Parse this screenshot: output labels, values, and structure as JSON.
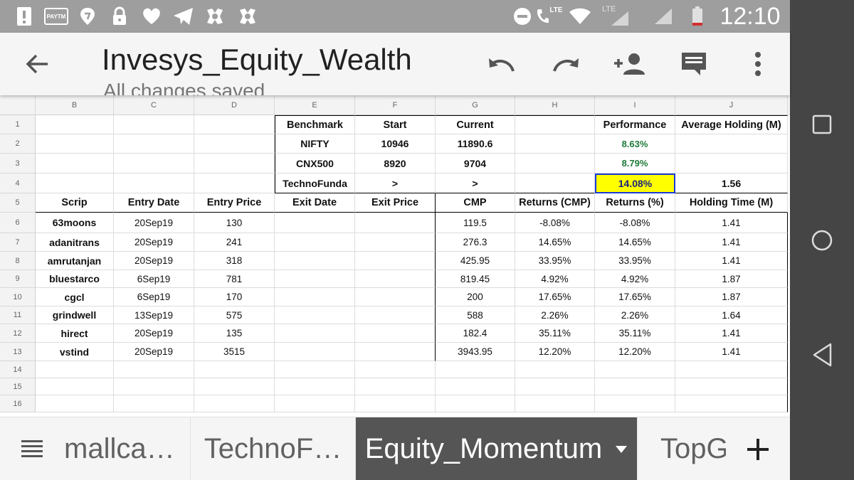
{
  "status_bar": {
    "time": "12:10",
    "paytm_label": "PAYTM",
    "lte_label_1": "LTE",
    "lte_label_2": "LTE"
  },
  "app_bar": {
    "title": "Invesys_Equity_Wealth",
    "subtitle": "All changes saved"
  },
  "columns": [
    "B",
    "C",
    "D",
    "E",
    "F",
    "G",
    "H",
    "I",
    "J"
  ],
  "rows": [
    "1",
    "2",
    "3",
    "4",
    "5",
    "6",
    "7",
    "8",
    "9",
    "10",
    "11",
    "12",
    "13",
    "14",
    "15",
    "16"
  ],
  "benchmark": {
    "headers": {
      "benchmark": "Benchmark",
      "start": "Start",
      "current": "Current",
      "performance": "Performance",
      "avg_holding": "Average Holding (M)"
    },
    "items": [
      {
        "name": "NIFTY",
        "start": "10946",
        "current": "11890.6",
        "performance": "8.63%"
      },
      {
        "name": "CNX500",
        "start": "8920",
        "current": "9704",
        "performance": "8.79%"
      },
      {
        "name": "TechnoFunda",
        "start": ">",
        "current": ">",
        "performance": "14.08%",
        "avg_holding": "1.56"
      }
    ]
  },
  "table": {
    "headers": [
      "Scrip",
      "Entry Date",
      "Entry Price",
      "Exit Date",
      "Exit Price",
      "CMP",
      "Returns (CMP)",
      "Returns (%)",
      "Holding Time (M)"
    ],
    "rows": [
      {
        "scrip": "63moons",
        "entry_date": "20Sep19",
        "entry_price": "130",
        "cmp": "119.5",
        "ret_cmp": "-8.08%",
        "ret_pct": "-8.08%",
        "hold": "1.41"
      },
      {
        "scrip": "adanitrans",
        "entry_date": "20Sep19",
        "entry_price": "241",
        "cmp": "276.3",
        "ret_cmp": "14.65%",
        "ret_pct": "14.65%",
        "hold": "1.41"
      },
      {
        "scrip": "amrutanjan",
        "entry_date": "20Sep19",
        "entry_price": "318",
        "cmp": "425.95",
        "ret_cmp": "33.95%",
        "ret_pct": "33.95%",
        "hold": "1.41"
      },
      {
        "scrip": "bluestarco",
        "entry_date": "6Sep19",
        "entry_price": "781",
        "cmp": "819.45",
        "ret_cmp": "4.92%",
        "ret_pct": "4.92%",
        "hold": "1.87"
      },
      {
        "scrip": "cgcl",
        "entry_date": "6Sep19",
        "entry_price": "170",
        "cmp": "200",
        "ret_cmp": "17.65%",
        "ret_pct": "17.65%",
        "hold": "1.87"
      },
      {
        "scrip": "grindwell",
        "entry_date": "13Sep19",
        "entry_price": "575",
        "cmp": "588",
        "ret_cmp": "2.26%",
        "ret_pct": "2.26%",
        "hold": "1.64"
      },
      {
        "scrip": "hirect",
        "entry_date": "20Sep19",
        "entry_price": "135",
        "cmp": "182.4",
        "ret_cmp": "35.11%",
        "ret_pct": "35.11%",
        "hold": "1.41"
      },
      {
        "scrip": "vstind",
        "entry_date": "20Sep19",
        "entry_price": "3515",
        "cmp": "3943.95",
        "ret_cmp": "12.20%",
        "ret_pct": "12.20%",
        "hold": "1.41"
      }
    ]
  },
  "tabs": [
    {
      "label": "mallca…",
      "active": false
    },
    {
      "label": "TechnoF…",
      "active": false
    },
    {
      "label": "Equity_Momentum",
      "active": true
    },
    {
      "label": "TopGa",
      "active": false
    }
  ],
  "colors": {
    "selected_fill": "#ffff00",
    "selected_border": "#1a3bd6",
    "positive_text": "#1e7a3a",
    "active_tab": "#555555"
  }
}
